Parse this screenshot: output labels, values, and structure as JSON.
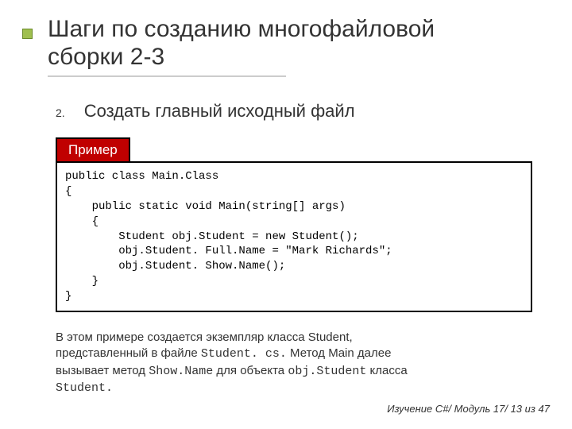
{
  "title_line1": "Шаги по созданию многофайловой",
  "title_line2": "сборки 2-3",
  "step": {
    "number": "2.",
    "text": "Создать главный исходный файл"
  },
  "example_label": "Пример",
  "code": "public class Main.Class\n{\n    public static void Main(string[] args)\n    {\n        Student obj.Student = new Student();\n        obj.Student. Full.Name = \"Mark Richards\";\n        obj.Student. Show.Name();\n    }\n}",
  "paragraph": {
    "p1": "В этом примере создается экземпляр класса Student,",
    "p2a": "представленный в файле ",
    "p2b": "Student. cs.",
    "p2c": " Метод Main далее",
    "p3a": "вызывает метод ",
    "p3b": "Show.Name",
    "p3c": " для объекта ",
    "p3d": "obj.Student",
    "p3e": " класса",
    "p4": "Student."
  },
  "footer": "Изучение C#/ Модуль 17/ 13 из 47"
}
